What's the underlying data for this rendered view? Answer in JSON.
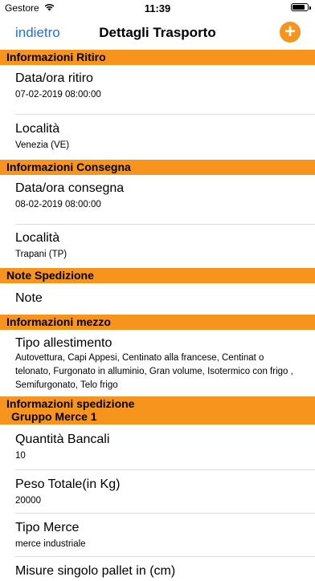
{
  "status": {
    "carrier": "Gestore",
    "time": "11:39",
    "battery_level": 0.85
  },
  "nav": {
    "back": "indietro",
    "title": "Dettagli Trasporto",
    "add": "+"
  },
  "sections": {
    "ritiro": {
      "header": "Informazioni Ritiro",
      "datetime": {
        "label": "Data/ora ritiro",
        "value": "07-02-2019 08:00:00"
      },
      "location": {
        "label": "Località",
        "value": "Venezia (VE)"
      }
    },
    "consegna": {
      "header": "Informazioni Consegna",
      "datetime": {
        "label": "Data/ora consegna",
        "value": "08-02-2019 08:00:00"
      },
      "location": {
        "label": "Località",
        "value": "Trapani (TP)"
      }
    },
    "note": {
      "header": "Note Spedizione",
      "notes": {
        "label": "Note"
      }
    },
    "mezzo": {
      "header": "Informazioni mezzo",
      "setup": {
        "label": "Tipo allestimento",
        "value": "Autovettura, Capi Appesi, Centinato alla francese, Centinat o telonato, Furgonato in alluminio, Gran volume, Isotermico con frigo , Semifurgonato, Telo frigo"
      }
    },
    "spedizione": {
      "header": "Informazioni spedizione",
      "subheader": "Gruppo Merce 1",
      "pallets": {
        "label": "Quantità Bancali",
        "value": "10"
      },
      "weight": {
        "label": "Peso Totale(in Kg)",
        "value": "20000"
      },
      "goods": {
        "label": "Tipo Merce",
        "value": "merce industriale"
      },
      "pallet_size": {
        "label": "Misure singolo pallet in (cm)"
      }
    }
  }
}
